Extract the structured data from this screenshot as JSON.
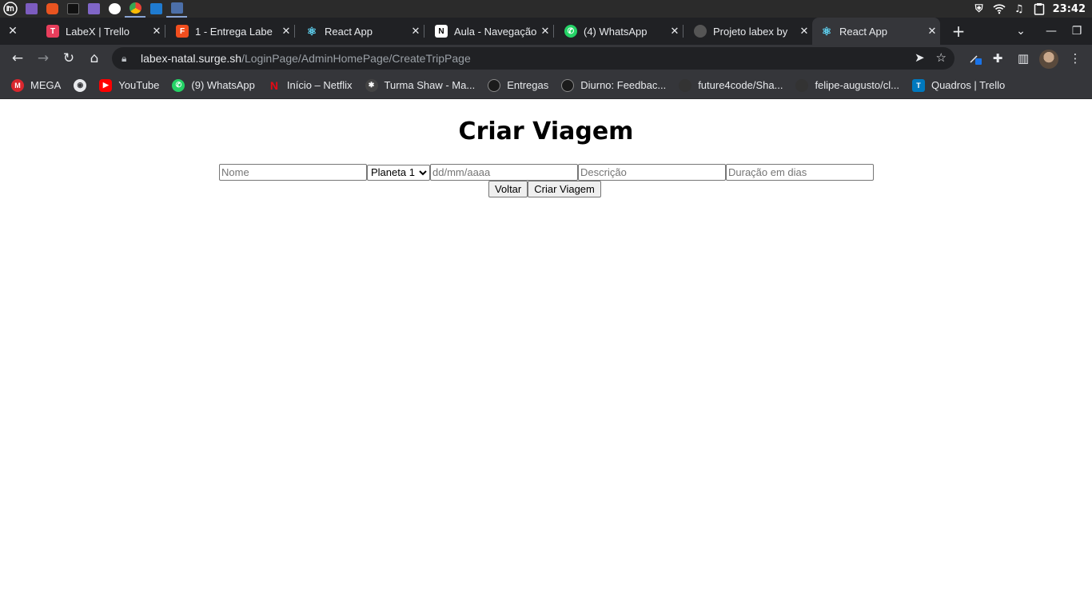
{
  "os_panel": {
    "clock": "23:42"
  },
  "tabs": [
    {
      "title": "LabeX | Trello",
      "fav_color": "#e83e5c",
      "fav_icon": "trello-icon"
    },
    {
      "title": "1 - Entrega Labe",
      "fav_color": "#f24e1e",
      "fav_icon": "figma-icon"
    },
    {
      "title": "React App",
      "fav_color": "#61dafb",
      "fav_icon": "react-icon"
    },
    {
      "title": "Aula - Navegação",
      "fav_color": "#ffffff",
      "fav_icon": "notion-icon"
    },
    {
      "title": "(4) WhatsApp",
      "fav_color": "#25d366",
      "fav_icon": "whatsapp-icon"
    },
    {
      "title": "Projeto labex by",
      "fav_color": "#555555",
      "fav_icon": "github-icon"
    },
    {
      "title": "React App",
      "fav_color": "#61dafb",
      "fav_icon": "react-icon",
      "active": true
    }
  ],
  "address_bar": {
    "host": "labex-natal.surge.sh",
    "path": "/LoginPage/AdminHomePage/CreateTripPage"
  },
  "bookmarks": [
    {
      "label": "MEGA",
      "color": "#d9272e"
    },
    {
      "label": "",
      "color": "#e8eaed"
    },
    {
      "label": "YouTube",
      "color": "#ff0000"
    },
    {
      "label": "(9) WhatsApp",
      "color": "#25d366"
    },
    {
      "label": "Início – Netflix",
      "color": "#e50914"
    },
    {
      "label": "Turma Shaw - Ma...",
      "color": "#444444"
    },
    {
      "label": "Entregas",
      "color": "#1b1b1b"
    },
    {
      "label": "Diurno: Feedbac...",
      "color": "#1b1b1b"
    },
    {
      "label": "future4code/Sha...",
      "color": "#333333"
    },
    {
      "label": "felipe-augusto/cl...",
      "color": "#333333"
    },
    {
      "label": "Quadros | Trello",
      "color": "#0079bf"
    }
  ],
  "page": {
    "title": "Criar Viagem",
    "form": {
      "name_placeholder": "Nome",
      "planet_selected": "Planeta 1",
      "date_placeholder": "dd/mm/aaaa",
      "description_placeholder": "Descrição",
      "duration_placeholder": "Duração em dias"
    },
    "back_button": "Voltar",
    "create_button": "Criar Viagem"
  }
}
